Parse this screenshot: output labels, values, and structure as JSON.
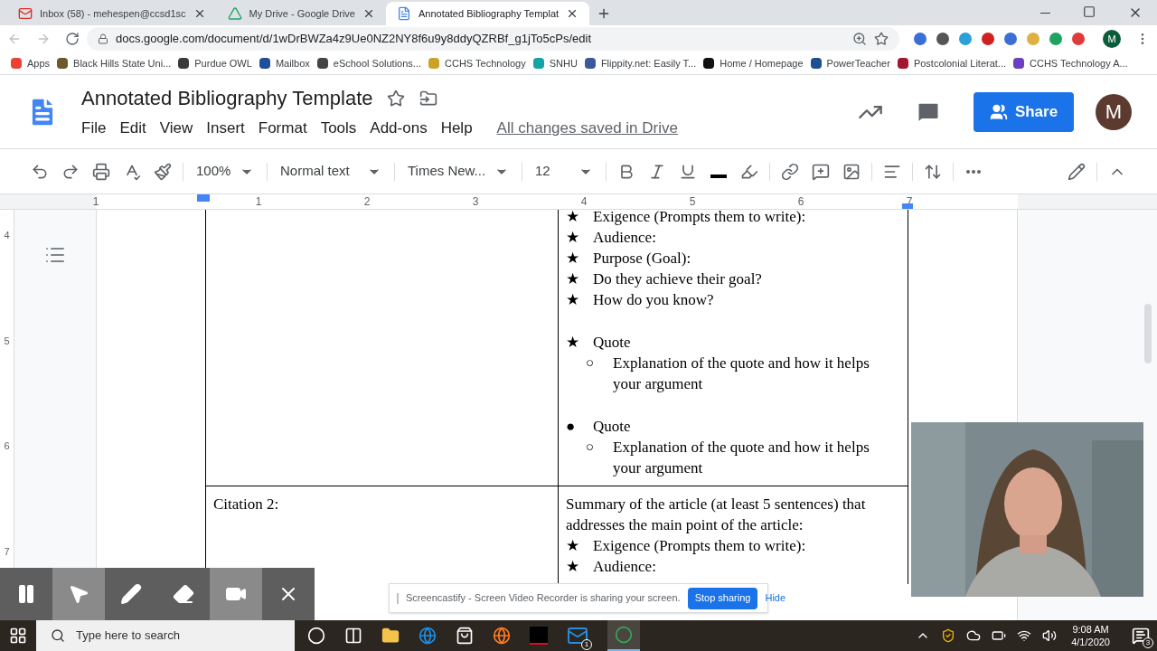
{
  "browser": {
    "tabs": [
      {
        "title": "Inbox (58) - mehespen@ccsd1sc",
        "selected": false
      },
      {
        "title": "My Drive - Google Drive",
        "selected": false
      },
      {
        "title": "Annotated Bibliography Templat",
        "selected": true
      }
    ],
    "url": "docs.google.com/document/d/1wDrBWZa4z9Ue0NZ2NY8f6u9y8ddyQZRBf_g1jTo5cPs/edit",
    "extensions": [
      {
        "color": "#3b6fd6"
      },
      {
        "color": "#555555"
      },
      {
        "color": "#2a9fd8"
      },
      {
        "color": "#d02020"
      },
      {
        "color": "#3b6fd6"
      },
      {
        "color": "#e0b040"
      },
      {
        "color": "#1ea362"
      },
      {
        "color": "#e03a3a"
      }
    ],
    "profile": "M",
    "bookmarks": [
      {
        "label": "Apps",
        "color": "#e94235"
      },
      {
        "label": "Black Hills State Uni...",
        "color": "#6b5a2a"
      },
      {
        "label": "Purdue OWL",
        "color": "#3a3a3a"
      },
      {
        "label": "Mailbox",
        "color": "#1f4f9a"
      },
      {
        "label": "eSchool Solutions...",
        "color": "#444444"
      },
      {
        "label": "CCHS Technology",
        "color": "#c9a227"
      },
      {
        "label": "SNHU",
        "color": "#17a3a3"
      },
      {
        "label": "Flippity.net: Easily T...",
        "color": "#3b5998"
      },
      {
        "label": "Home / Homepage",
        "color": "#111111"
      },
      {
        "label": "PowerTeacher",
        "color": "#1d4f91"
      },
      {
        "label": "Postcolonial Literat...",
        "color": "#a3162b"
      },
      {
        "label": "CCHS Technology A...",
        "color": "#6a3fc1"
      }
    ]
  },
  "docs": {
    "title": "Annotated Bibliography Template",
    "menus": [
      "File",
      "Edit",
      "View",
      "Insert",
      "Format",
      "Tools",
      "Add-ons",
      "Help"
    ],
    "save_status": "All changes saved in Drive",
    "share": "Share",
    "avatar": "M",
    "toolbar": {
      "zoom": "100%",
      "style": "Normal text",
      "font": "Times New...",
      "size": "12"
    },
    "ruler": {
      "horizontal": [
        "1",
        "1",
        "2",
        "3",
        "4",
        "5",
        "6",
        "7"
      ],
      "vertical": [
        "4",
        "5",
        "6",
        "7"
      ]
    },
    "table": {
      "rows": [
        {
          "citation": null,
          "intro": null,
          "blocks": [
            [
              {
                "marker": "★",
                "text": "Exigence (Prompts them to write):"
              },
              {
                "marker": "★",
                "text": "Audience:"
              },
              {
                "marker": "★",
                "text": "Purpose (Goal):"
              },
              {
                "marker": "★",
                "text": "Do they achieve their goal?"
              },
              {
                "marker": "★",
                "text": "How do you know?"
              }
            ],
            [
              {
                "marker": "★",
                "text": "Quote",
                "children": [
                  {
                    "marker": "○",
                    "text": "Explanation of the quote and how it helps your argument"
                  }
                ]
              }
            ],
            [
              {
                "marker": "●",
                "text": "Quote",
                "children": [
                  {
                    "marker": "○",
                    "text": "Explanation of the quote and how it helps your argument"
                  }
                ]
              }
            ]
          ]
        },
        {
          "citation": "Citation 2:",
          "intro": "Summary of the article (at least 5 sentences) that addresses the main point of the article:",
          "blocks": [
            [
              {
                "marker": "★",
                "text": "Exigence (Prompts them to write):"
              },
              {
                "marker": "★",
                "text": "Audience:"
              }
            ]
          ]
        }
      ]
    }
  },
  "recorder": {
    "tools": [
      {
        "kind": "pause",
        "selected": false
      },
      {
        "kind": "pointer",
        "selected": true
      },
      {
        "kind": "pen",
        "selected": false
      },
      {
        "kind": "eraser",
        "selected": false
      },
      {
        "kind": "camera",
        "selected": true
      },
      {
        "kind": "close",
        "selected": false
      }
    ]
  },
  "sharing_bar": {
    "message": "Screencastify - Screen Video Recorder is sharing your screen.",
    "stop": "Stop sharing",
    "hide": "Hide"
  },
  "taskbar": {
    "search_placeholder": "Type here to search",
    "mail_badge": "1",
    "time": "9:08 AM",
    "date": "4/1/2020",
    "notifications": "3"
  }
}
